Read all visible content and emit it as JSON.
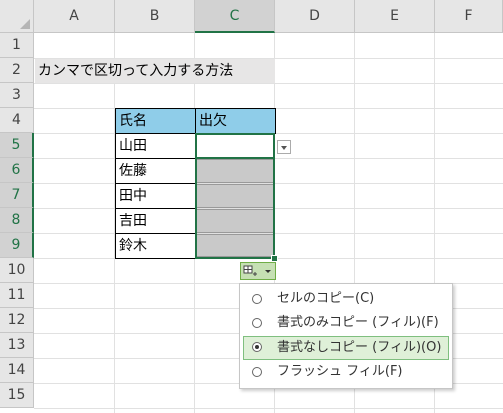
{
  "columns": [
    "A",
    "B",
    "C",
    "D",
    "E",
    "F"
  ],
  "rows": [
    "1",
    "2",
    "3",
    "4",
    "5",
    "6",
    "7",
    "8",
    "9",
    "10",
    "11",
    "12",
    "13",
    "14",
    "15"
  ],
  "title_cell": "カンマで区切って入力する方法",
  "table": {
    "headers": [
      "氏名",
      "出欠"
    ],
    "names": [
      "山田",
      "佐藤",
      "田中",
      "吉田",
      "鈴木"
    ]
  },
  "autofill_menu": {
    "options": [
      {
        "label": "セルのコピー(C)",
        "selected": false
      },
      {
        "label": "書式のみコピー (フィル)(F)",
        "selected": false
      },
      {
        "label": "書式なしコピー (フィル)(O)",
        "selected": true
      },
      {
        "label": "フラッシュ フィル(F)",
        "selected": false
      }
    ]
  },
  "colors": {
    "header_fill": "#8fcde9",
    "title_fill": "#e7e6e6",
    "selection_green": "#217346",
    "grey_fill": "#c9c9c9"
  },
  "icons": {
    "dropdown": "chevron-down-icon",
    "autofill_options": "autofill-options-icon"
  }
}
